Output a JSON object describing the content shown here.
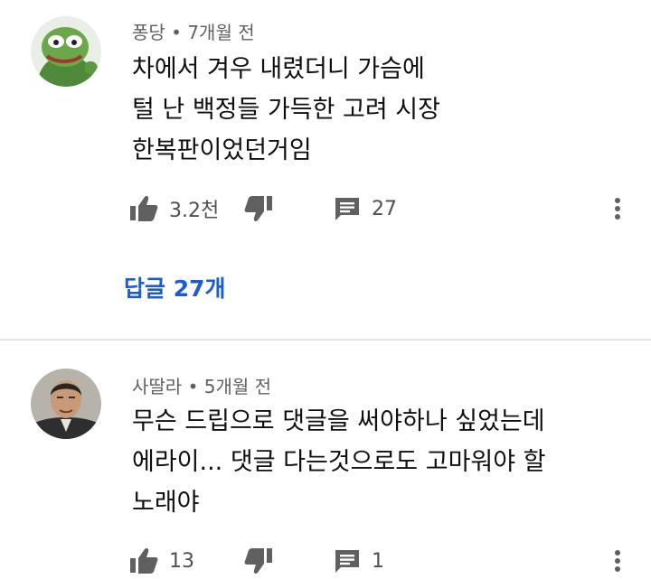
{
  "comments": [
    {
      "author": "퐁당",
      "time": "7개월 전",
      "lines": [
        "차에서 겨우 내렸더니 가슴에",
        "털 난 백정들 가득한 고려 시장",
        "한복판이었던거임"
      ],
      "likes": "3.2천",
      "replies": "27",
      "replies_link": "답글 27개",
      "avatar_icon": "frog-avatar-icon"
    },
    {
      "author": "사딸라",
      "time": "5개월 전",
      "lines": [
        "무슨 드립으로 댓글을 써야하나 싶었는데",
        "에라이... 댓글 다는것으로도 고마워야 할",
        "노래야"
      ],
      "likes": "13",
      "replies": "1",
      "avatar_icon": "man-portrait-avatar-icon"
    }
  ],
  "separator": "•",
  "colors": {
    "link": "#1a5bd6",
    "meta": "#606060",
    "icon": "#606060"
  }
}
